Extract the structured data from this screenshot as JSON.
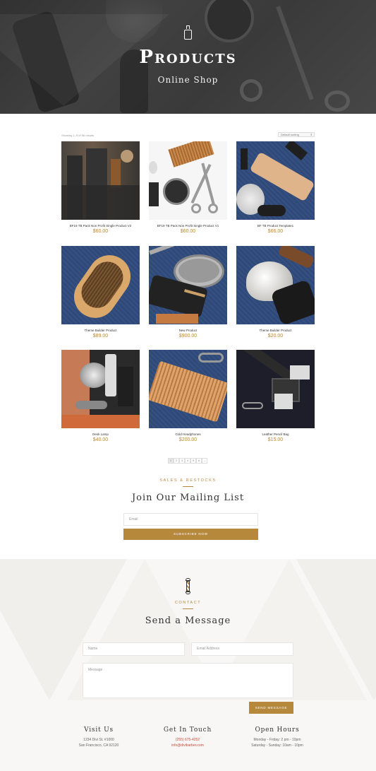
{
  "hero": {
    "title": "Products",
    "subtitle": "Online Shop",
    "icon": "spray-bottle-icon"
  },
  "shop": {
    "result_count": "Showing 1–9 of 56 results",
    "sort_selected": "Default sorting"
  },
  "products": [
    {
      "name": "BF19 TB Pack Non Profit Single Product V2",
      "price": "$60.00",
      "image": "dark-bottles-brush"
    },
    {
      "name": "BF19 TB Pack Non Profit Single Product V1",
      "price": "$60.00",
      "image": "comb-scissors-tin"
    },
    {
      "name": "BF TB Product Template1",
      "price": "$66.00",
      "image": "wood-handles-brush"
    },
    {
      "name": "Theme Builder Product",
      "price": "$89.00",
      "image": "bristle-brush"
    },
    {
      "name": "New Product",
      "price": "$900.00",
      "image": "pomade-tin"
    },
    {
      "name": "Theme Builder Product",
      "price": "$20.00",
      "image": "shaving-brush"
    },
    {
      "name": "Desk Lamp",
      "price": "$40.00",
      "image": "barber-tools"
    },
    {
      "name": "Gold Headphones",
      "price": "$200.00",
      "image": "wooden-comb"
    },
    {
      "name": "Leather Pencil Bag",
      "price": "$15.00",
      "image": "clipper-guards"
    }
  ],
  "pagination": {
    "pages": [
      "1",
      "2",
      "3",
      "4",
      "5",
      "6",
      "→"
    ],
    "current": "1"
  },
  "mailing": {
    "kicker": "SALES & RESTOCKS",
    "title": "Join Our Mailing List",
    "email_placeholder": "Email",
    "button": "SUBSCRIBE NOW"
  },
  "contact": {
    "icon": "barber-pole-icon",
    "kicker": "CONTACT",
    "title": "Send a Message",
    "name_placeholder": "Name",
    "email_placeholder": "Email Address",
    "message_placeholder": "Message",
    "button": "SEND MESSAGE"
  },
  "footer": {
    "visit": {
      "heading": "Visit Us",
      "line1": "1234 Divi St. #1000",
      "line2": "San Francisco, CA 92120"
    },
    "touch": {
      "heading": "Get In Touch",
      "line1": "(255) 675-4252",
      "line2": "info@divibarber.com"
    },
    "hours": {
      "heading": "Open Hours",
      "line1": "Monday - Friday: 2 pm - 10pm",
      "line2": "Saturday - Sunday: 10am - 10pm"
    }
  },
  "colors": {
    "accent": "#b5883c",
    "link": "#c94a3a",
    "denim": "#2f4a7a"
  }
}
